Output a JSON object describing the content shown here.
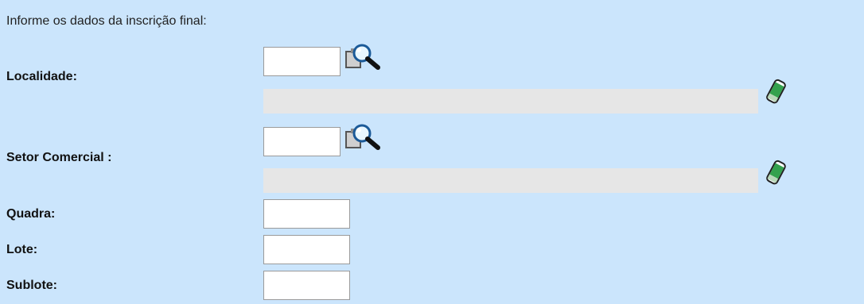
{
  "intro_text": "Informe os dados da inscrição final:",
  "fields": {
    "localidade": {
      "label": "Localidade:",
      "code_value": "",
      "description": ""
    },
    "setor_comercial": {
      "label": "Setor Comercial :",
      "code_value": "",
      "description": ""
    },
    "quadra": {
      "label": "Quadra:",
      "value": ""
    },
    "lote": {
      "label": "Lote:",
      "value": ""
    },
    "sublote": {
      "label": "Sublote:",
      "value": ""
    }
  },
  "icons": {
    "search": "search-icon",
    "clear": "eraser-icon"
  },
  "colors": {
    "background": "#cbe5fc",
    "readonly_field": "#e6e6e6"
  }
}
